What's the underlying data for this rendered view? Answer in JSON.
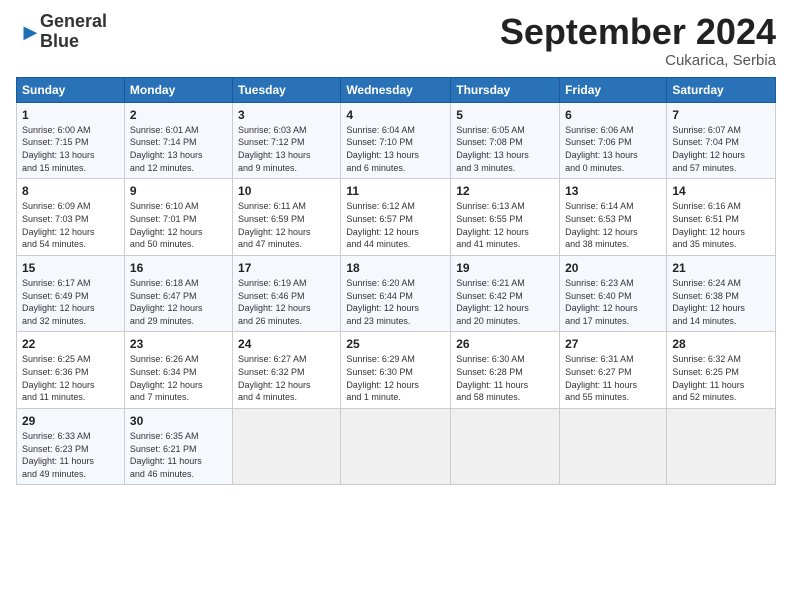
{
  "header": {
    "logo_general": "General",
    "logo_blue": "Blue",
    "month_title": "September 2024",
    "subtitle": "Cukarica, Serbia"
  },
  "days_of_week": [
    "Sunday",
    "Monday",
    "Tuesday",
    "Wednesday",
    "Thursday",
    "Friday",
    "Saturday"
  ],
  "weeks": [
    [
      {
        "day": "1",
        "info": "Sunrise: 6:00 AM\nSunset: 7:15 PM\nDaylight: 13 hours\nand 15 minutes."
      },
      {
        "day": "2",
        "info": "Sunrise: 6:01 AM\nSunset: 7:14 PM\nDaylight: 13 hours\nand 12 minutes."
      },
      {
        "day": "3",
        "info": "Sunrise: 6:03 AM\nSunset: 7:12 PM\nDaylight: 13 hours\nand 9 minutes."
      },
      {
        "day": "4",
        "info": "Sunrise: 6:04 AM\nSunset: 7:10 PM\nDaylight: 13 hours\nand 6 minutes."
      },
      {
        "day": "5",
        "info": "Sunrise: 6:05 AM\nSunset: 7:08 PM\nDaylight: 13 hours\nand 3 minutes."
      },
      {
        "day": "6",
        "info": "Sunrise: 6:06 AM\nSunset: 7:06 PM\nDaylight: 13 hours\nand 0 minutes."
      },
      {
        "day": "7",
        "info": "Sunrise: 6:07 AM\nSunset: 7:04 PM\nDaylight: 12 hours\nand 57 minutes."
      }
    ],
    [
      {
        "day": "8",
        "info": "Sunrise: 6:09 AM\nSunset: 7:03 PM\nDaylight: 12 hours\nand 54 minutes."
      },
      {
        "day": "9",
        "info": "Sunrise: 6:10 AM\nSunset: 7:01 PM\nDaylight: 12 hours\nand 50 minutes."
      },
      {
        "day": "10",
        "info": "Sunrise: 6:11 AM\nSunset: 6:59 PM\nDaylight: 12 hours\nand 47 minutes."
      },
      {
        "day": "11",
        "info": "Sunrise: 6:12 AM\nSunset: 6:57 PM\nDaylight: 12 hours\nand 44 minutes."
      },
      {
        "day": "12",
        "info": "Sunrise: 6:13 AM\nSunset: 6:55 PM\nDaylight: 12 hours\nand 41 minutes."
      },
      {
        "day": "13",
        "info": "Sunrise: 6:14 AM\nSunset: 6:53 PM\nDaylight: 12 hours\nand 38 minutes."
      },
      {
        "day": "14",
        "info": "Sunrise: 6:16 AM\nSunset: 6:51 PM\nDaylight: 12 hours\nand 35 minutes."
      }
    ],
    [
      {
        "day": "15",
        "info": "Sunrise: 6:17 AM\nSunset: 6:49 PM\nDaylight: 12 hours\nand 32 minutes."
      },
      {
        "day": "16",
        "info": "Sunrise: 6:18 AM\nSunset: 6:47 PM\nDaylight: 12 hours\nand 29 minutes."
      },
      {
        "day": "17",
        "info": "Sunrise: 6:19 AM\nSunset: 6:46 PM\nDaylight: 12 hours\nand 26 minutes."
      },
      {
        "day": "18",
        "info": "Sunrise: 6:20 AM\nSunset: 6:44 PM\nDaylight: 12 hours\nand 23 minutes."
      },
      {
        "day": "19",
        "info": "Sunrise: 6:21 AM\nSunset: 6:42 PM\nDaylight: 12 hours\nand 20 minutes."
      },
      {
        "day": "20",
        "info": "Sunrise: 6:23 AM\nSunset: 6:40 PM\nDaylight: 12 hours\nand 17 minutes."
      },
      {
        "day": "21",
        "info": "Sunrise: 6:24 AM\nSunset: 6:38 PM\nDaylight: 12 hours\nand 14 minutes."
      }
    ],
    [
      {
        "day": "22",
        "info": "Sunrise: 6:25 AM\nSunset: 6:36 PM\nDaylight: 12 hours\nand 11 minutes."
      },
      {
        "day": "23",
        "info": "Sunrise: 6:26 AM\nSunset: 6:34 PM\nDaylight: 12 hours\nand 7 minutes."
      },
      {
        "day": "24",
        "info": "Sunrise: 6:27 AM\nSunset: 6:32 PM\nDaylight: 12 hours\nand 4 minutes."
      },
      {
        "day": "25",
        "info": "Sunrise: 6:29 AM\nSunset: 6:30 PM\nDaylight: 12 hours\nand 1 minute."
      },
      {
        "day": "26",
        "info": "Sunrise: 6:30 AM\nSunset: 6:28 PM\nDaylight: 11 hours\nand 58 minutes."
      },
      {
        "day": "27",
        "info": "Sunrise: 6:31 AM\nSunset: 6:27 PM\nDaylight: 11 hours\nand 55 minutes."
      },
      {
        "day": "28",
        "info": "Sunrise: 6:32 AM\nSunset: 6:25 PM\nDaylight: 11 hours\nand 52 minutes."
      }
    ],
    [
      {
        "day": "29",
        "info": "Sunrise: 6:33 AM\nSunset: 6:23 PM\nDaylight: 11 hours\nand 49 minutes."
      },
      {
        "day": "30",
        "info": "Sunrise: 6:35 AM\nSunset: 6:21 PM\nDaylight: 11 hours\nand 46 minutes."
      },
      {
        "day": "",
        "info": ""
      },
      {
        "day": "",
        "info": ""
      },
      {
        "day": "",
        "info": ""
      },
      {
        "day": "",
        "info": ""
      },
      {
        "day": "",
        "info": ""
      }
    ]
  ]
}
